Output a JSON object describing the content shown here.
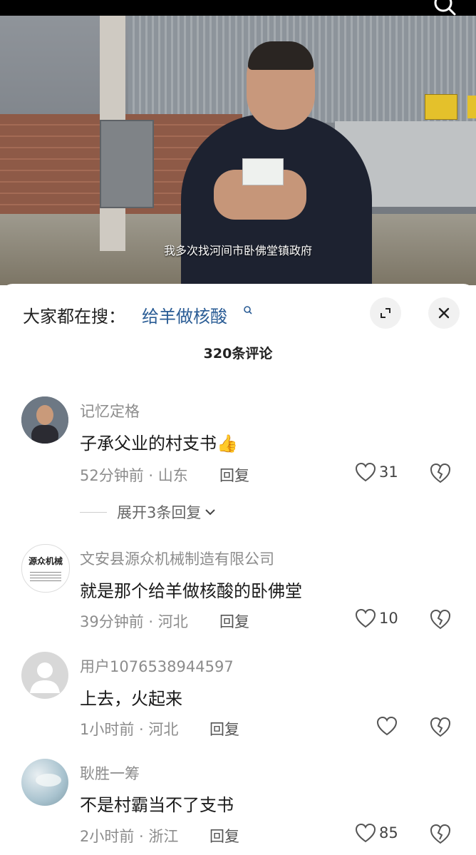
{
  "video": {
    "subtitle": "我多次找河间市卧佛堂镇政府"
  },
  "header": {
    "hot_label": "大家都在搜：",
    "hot_term": "给羊做核酸"
  },
  "comments_count": "320条评论",
  "comments": [
    {
      "username": "记忆定格",
      "text": "子承父业的村支书",
      "emoji": "👍",
      "time_location": "52分钟前 · 山东",
      "reply_label": "回复",
      "likes": "31",
      "expand_label": "展开3条回复"
    },
    {
      "username": "文安县源众机械制造有限公司",
      "avatar_text": "源众机械",
      "text": "就是那个给羊做核酸的卧佛堂",
      "time_location": "39分钟前 · 河北",
      "reply_label": "回复",
      "likes": "10"
    },
    {
      "username": "用户1076538944597",
      "text": "上去，火起来",
      "time_location": "1小时前 · 河北",
      "reply_label": "回复",
      "likes": ""
    },
    {
      "username": "耿胜一筹",
      "text": "不是村霸当不了支书",
      "time_location": "2小时前 · 浙江",
      "reply_label": "回复",
      "likes": "85"
    }
  ],
  "colors": {
    "hot_term": "#2a5c95",
    "meta_text": "#8c8c8c"
  }
}
